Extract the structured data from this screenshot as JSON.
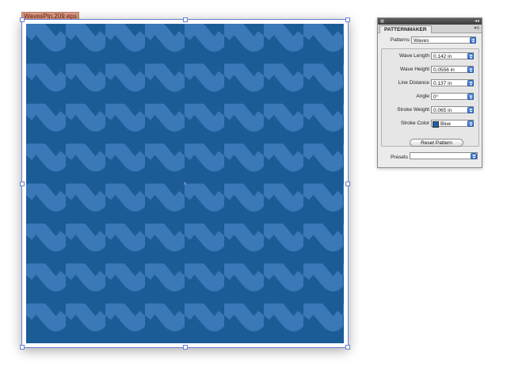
{
  "document": {
    "file_label": "WavesPtn.209.eps"
  },
  "panel": {
    "tab_label": "PATTERNMAKER",
    "patterns_label": "Patterns",
    "patterns_value": "Waves",
    "fields": [
      {
        "label": "Wave Length",
        "value": "0.142 in"
      },
      {
        "label": "Wave Height",
        "value": "0.0556 in"
      },
      {
        "label": "Line Distance",
        "value": "0.137 in"
      },
      {
        "label": "Angle",
        "value": "0°"
      },
      {
        "label": "Stroke Weight",
        "value": "0.065 in"
      },
      {
        "label": "Stroke Color",
        "value": "Blue"
      }
    ],
    "reset_label": "Reset Pattern",
    "presets_label": "Presets",
    "presets_value": ""
  },
  "colors": {
    "background": "#1b5c97",
    "wave": "#3a78b8",
    "swatch": "#1b5eab"
  },
  "icons": [
    "close-icon",
    "collapse-icon",
    "panel-menu-icon",
    "stepper-icon",
    "color-swatch-icon"
  ]
}
